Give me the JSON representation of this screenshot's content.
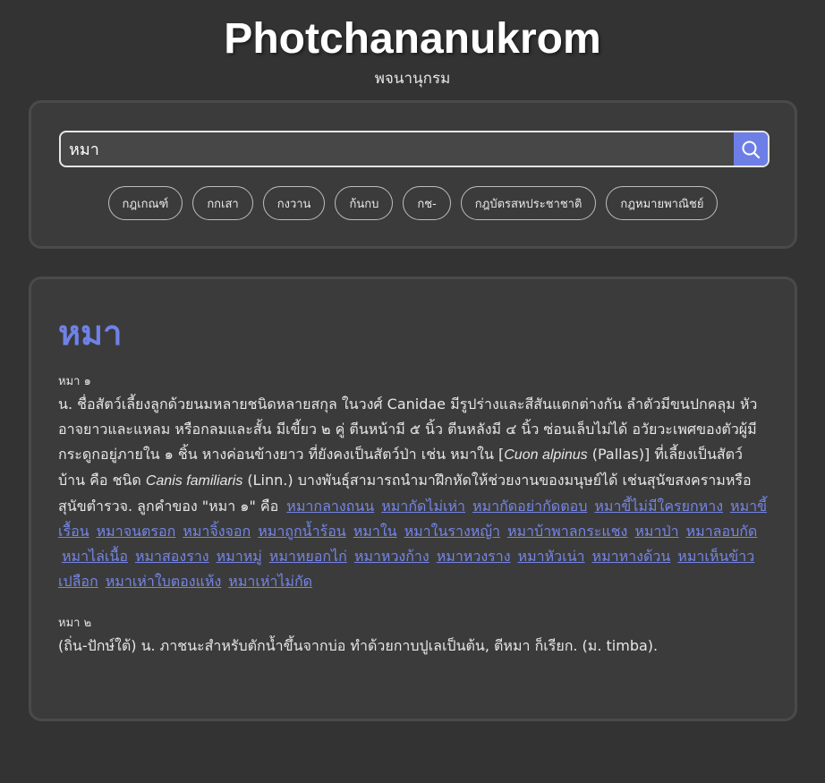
{
  "header": {
    "title": "Photchananukrom",
    "subtitle": "พจนานุกรม"
  },
  "search": {
    "value": "หมา",
    "chips": [
      "กฎเกณฑ์",
      "กกเสา",
      "กงวาน",
      "ก้นกบ",
      "กช-",
      "กฎบัตรสหประชาชาติ",
      "กฎหมายพาณิชย์"
    ]
  },
  "entry": {
    "title": "หมา",
    "sense1": {
      "label": "หมา ๑",
      "def_a": "น. ชื่อสัตว์เลี้ยงลูกด้วยนมหลายชนิดหลายสกุล ในวงศ์ Canidae มีรูปร่างและสีสันแตกต่างกัน ลำตัวมีขนปกคลุม หัวอาจยาวและแหลม หรือกลมและสั้น มีเขี้ยว ๒ คู่ ตีนหน้ามี ๕ นิ้ว ตีนหลังมี ๔ นิ้ว ซ่อนเล็บไม่ได้ อวัยวะเพศของตัวผู้มีกระดูกอยู่ภายใน ๑ ชิ้น หางค่อนข้างยาว ที่ยังคงเป็นสัตว์ป่า เช่น หมาใน [",
      "sci1": "Cuon alpinus",
      "def_b": " (Pallas)] ที่เลี้ยงเป็นสัตว์บ้าน คือ ชนิด ",
      "sci2": "Canis familiaris",
      "def_c": " (Linn.) บางพันธุ์สามารถนำมาฝึกหัดให้ช่วยงานของมนุษย์ได้ เช่นสุนัขสงครามหรือสุนัขตำรวจ.  ลูกคำของ \"หมา ๑\" คือ ",
      "related": [
        "หมากลางถนน",
        "หมากัดไม่เห่า",
        "หมากัดอย่ากัดตอบ",
        "หมาขี้ไม่มีใครยกหาง",
        "หมาขี้เรื้อน",
        "หมาจนตรอก",
        "หมาจิ้งจอก",
        "หมาถูกน้ำร้อน",
        "หมาใน",
        "หมาในรางหญ้า",
        "หมาบ้าพาลกระแชง",
        "หมาป่า",
        "หมาลอบกัด",
        "หมาไล่เนื้อ",
        "หมาสองราง",
        "หมาหมู่",
        "หมาหยอกไก่",
        "หมาหวงก้าง",
        "หมาหวงราง",
        "หมาหัวเน่า",
        "หมาหางด้วน",
        "หมาเห็นข้าวเปลือก",
        "หมาเห่าใบตองแห้ง",
        "หมาเห่าไม่กัด"
      ]
    },
    "sense2": {
      "label": "หมา ๒",
      "def": " (ถิ่น-ปักษ์ใต้) น. ภาชนะสำหรับตักน้ำขึ้นจากบ่อ ทำด้วยกาบปูเลเป็นต้น, ตีหมา ก็เรียก. (ม. timba)."
    }
  },
  "colors": {
    "background": "#333333",
    "card": "#3b3b3b",
    "accent": "#6d7fe6",
    "link": "#7586e6"
  },
  "icons": {
    "search_button": "search-icon"
  }
}
